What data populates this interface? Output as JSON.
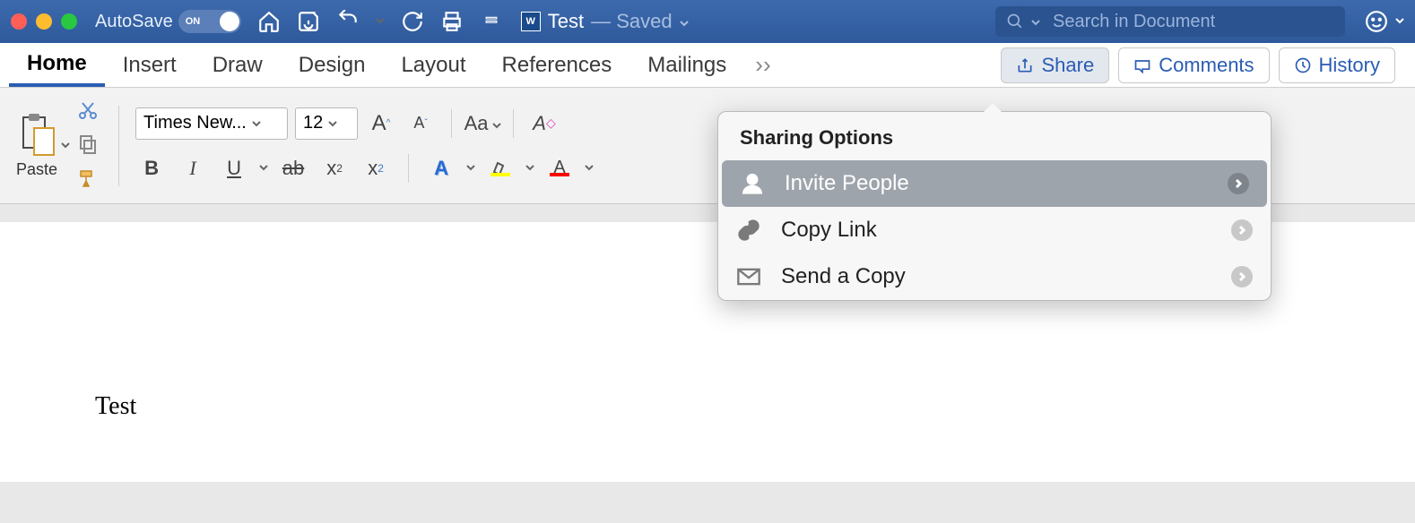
{
  "titlebar": {
    "autosave_label": "AutoSave",
    "autosave_state": "ON",
    "doc_name": "Test",
    "doc_status": "— Saved",
    "search_placeholder": "Search in Document"
  },
  "tabs": {
    "home": "Home",
    "insert": "Insert",
    "draw": "Draw",
    "design": "Design",
    "layout": "Layout",
    "references": "References",
    "mailings": "Mailings"
  },
  "ribbon_right": {
    "share": "Share",
    "comments": "Comments",
    "history": "History"
  },
  "toolbar": {
    "paste": "Paste",
    "font_name": "Times New...",
    "font_size": "12",
    "change_case": "Aa"
  },
  "share_popup": {
    "title": "Sharing Options",
    "invite": "Invite People",
    "copy_link": "Copy Link",
    "send_copy": "Send a Copy"
  },
  "document": {
    "body_text": "Test"
  }
}
